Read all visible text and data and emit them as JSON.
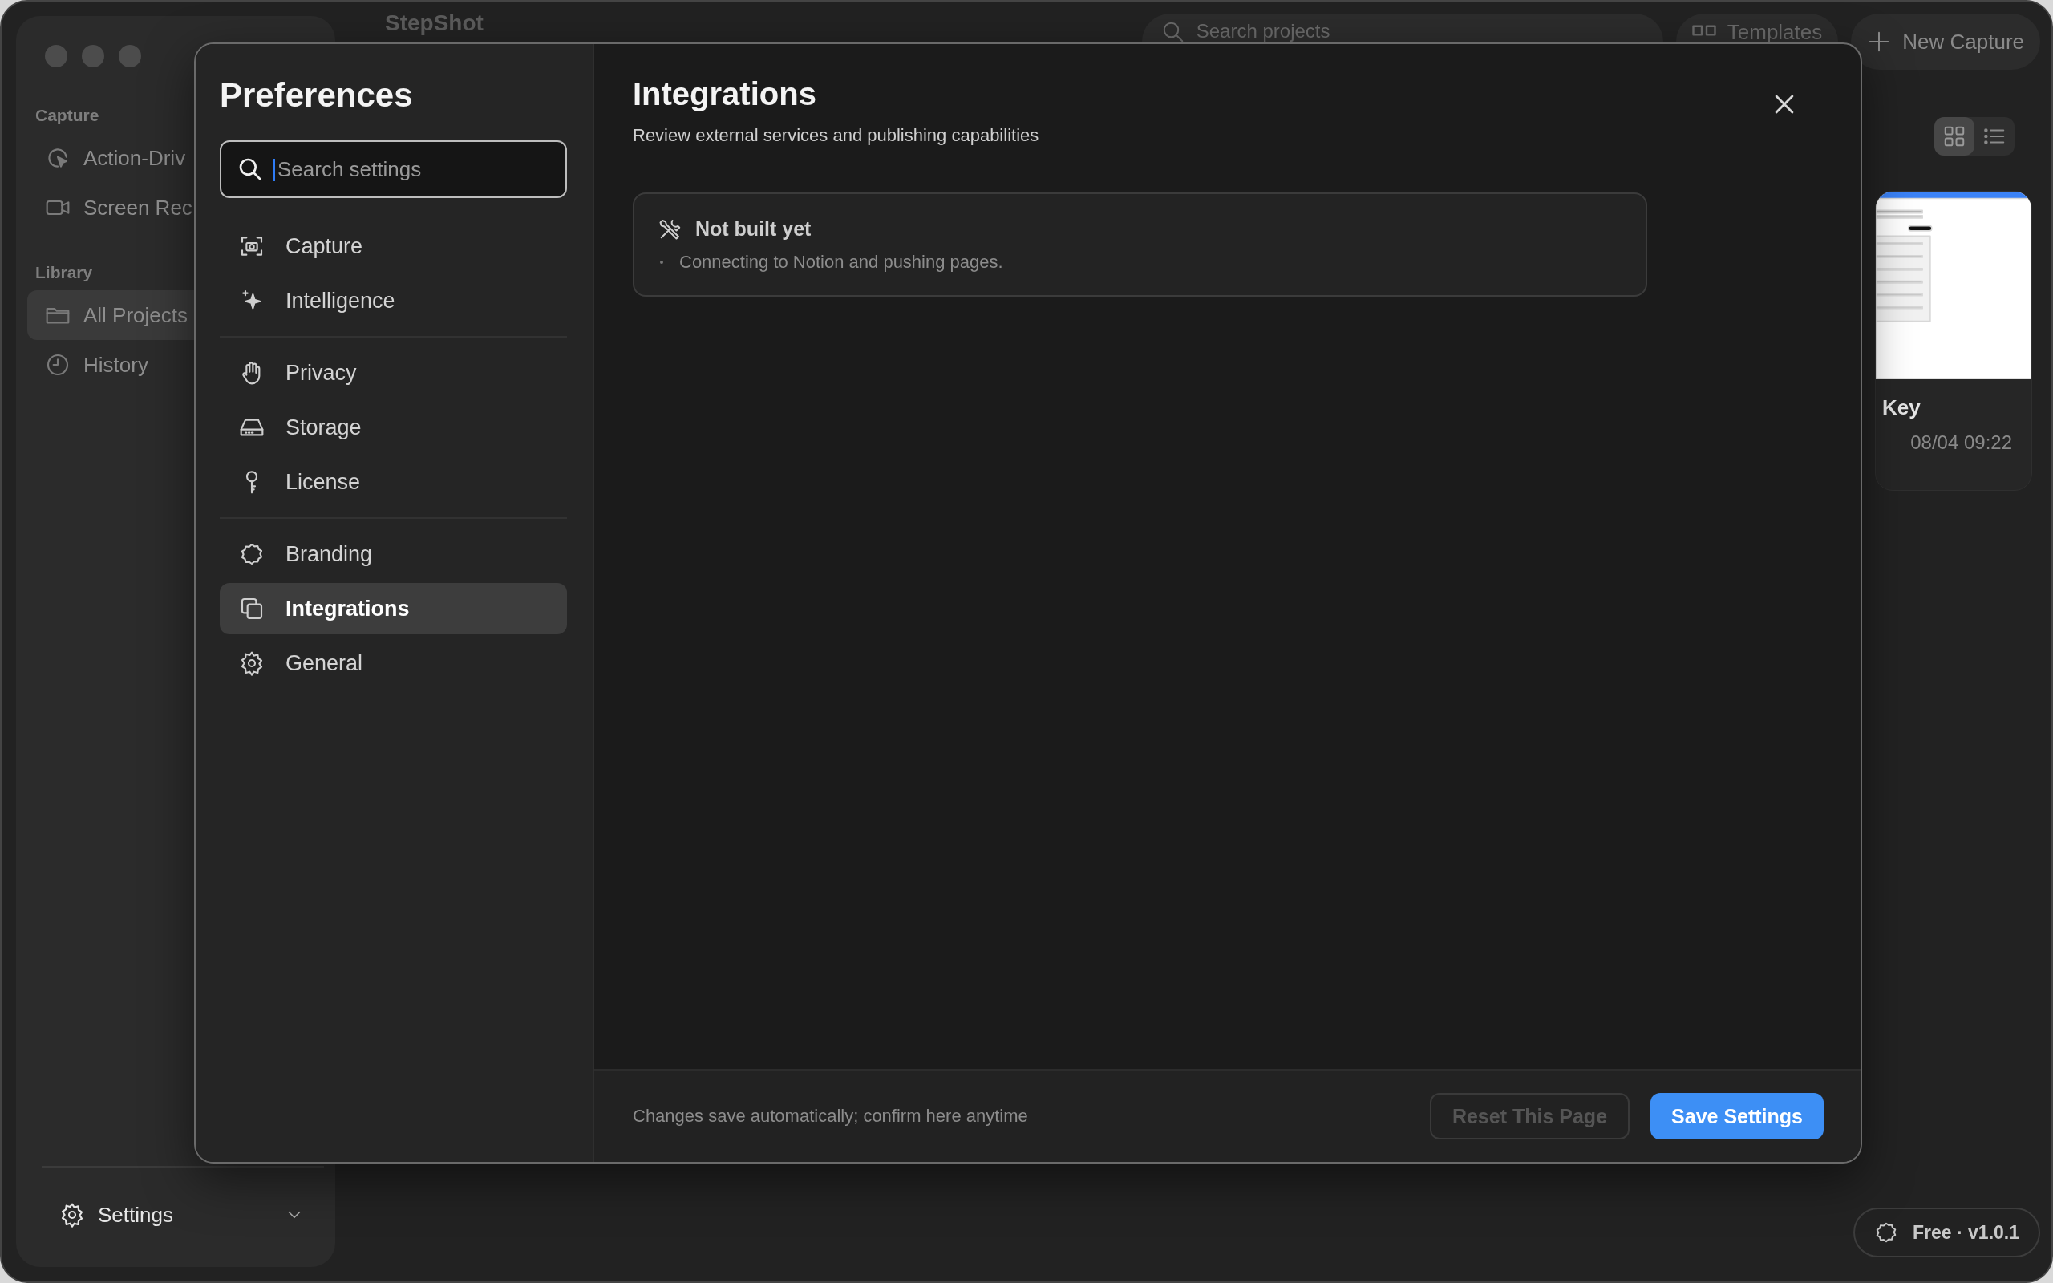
{
  "app": {
    "title": "StepShot",
    "search": {
      "placeholder": "Search projects"
    },
    "toolbar": [
      {
        "label": "Templates",
        "kind": "templates"
      },
      {
        "label": "New Capture",
        "kind": "new"
      }
    ],
    "view_toggle": [
      {
        "kind": "grid",
        "selected": true
      },
      {
        "kind": "list",
        "selected": false
      }
    ]
  },
  "sidebar": {
    "sections": [
      {
        "title": "Capture",
        "items": [
          {
            "label": "Action-Driv",
            "kind": "cursor",
            "selected": false
          },
          {
            "label": "Screen Rec",
            "kind": "video",
            "selected": false
          }
        ]
      },
      {
        "title": "Library",
        "items": [
          {
            "label": "All Projects",
            "kind": "folder",
            "selected": true
          },
          {
            "label": "History",
            "kind": "clock",
            "selected": false
          }
        ]
      }
    ],
    "footer": {
      "label": "Settings"
    }
  },
  "projects": [
    {
      "title": "Key",
      "date": "08/04 09:22"
    }
  ],
  "plan_badge": "Free · v1.0.1",
  "preferences": {
    "title": "Preferences",
    "search": {
      "placeholder": "Search settings"
    },
    "nav": [
      {
        "items": [
          {
            "label": "Capture",
            "kind": "camera",
            "selected": false
          },
          {
            "label": "Intelligence",
            "kind": "sparkle",
            "selected": false
          }
        ]
      },
      {
        "items": [
          {
            "label": "Privacy",
            "kind": "hand",
            "selected": false
          },
          {
            "label": "Storage",
            "kind": "drive",
            "selected": false
          },
          {
            "label": "License",
            "kind": "key",
            "selected": false
          }
        ]
      },
      {
        "items": [
          {
            "label": "Branding",
            "kind": "badge",
            "selected": false
          },
          {
            "label": "Integrations",
            "kind": "copy",
            "selected": true
          },
          {
            "label": "General",
            "kind": "gear",
            "selected": false
          }
        ]
      }
    ],
    "page": {
      "title": "Integrations",
      "subtitle": "Review external services and publishing capabilities",
      "cards": [
        {
          "title": "Not built yet",
          "lines": [
            "Connecting to Notion and pushing pages."
          ]
        }
      ]
    },
    "footer": {
      "note": "Changes save automatically; confirm here anytime",
      "buttons": [
        {
          "label": "Reset This Page",
          "kind": "secondary",
          "disabled": true
        },
        {
          "label": "Save Settings",
          "kind": "primary",
          "disabled": false
        }
      ]
    }
  }
}
